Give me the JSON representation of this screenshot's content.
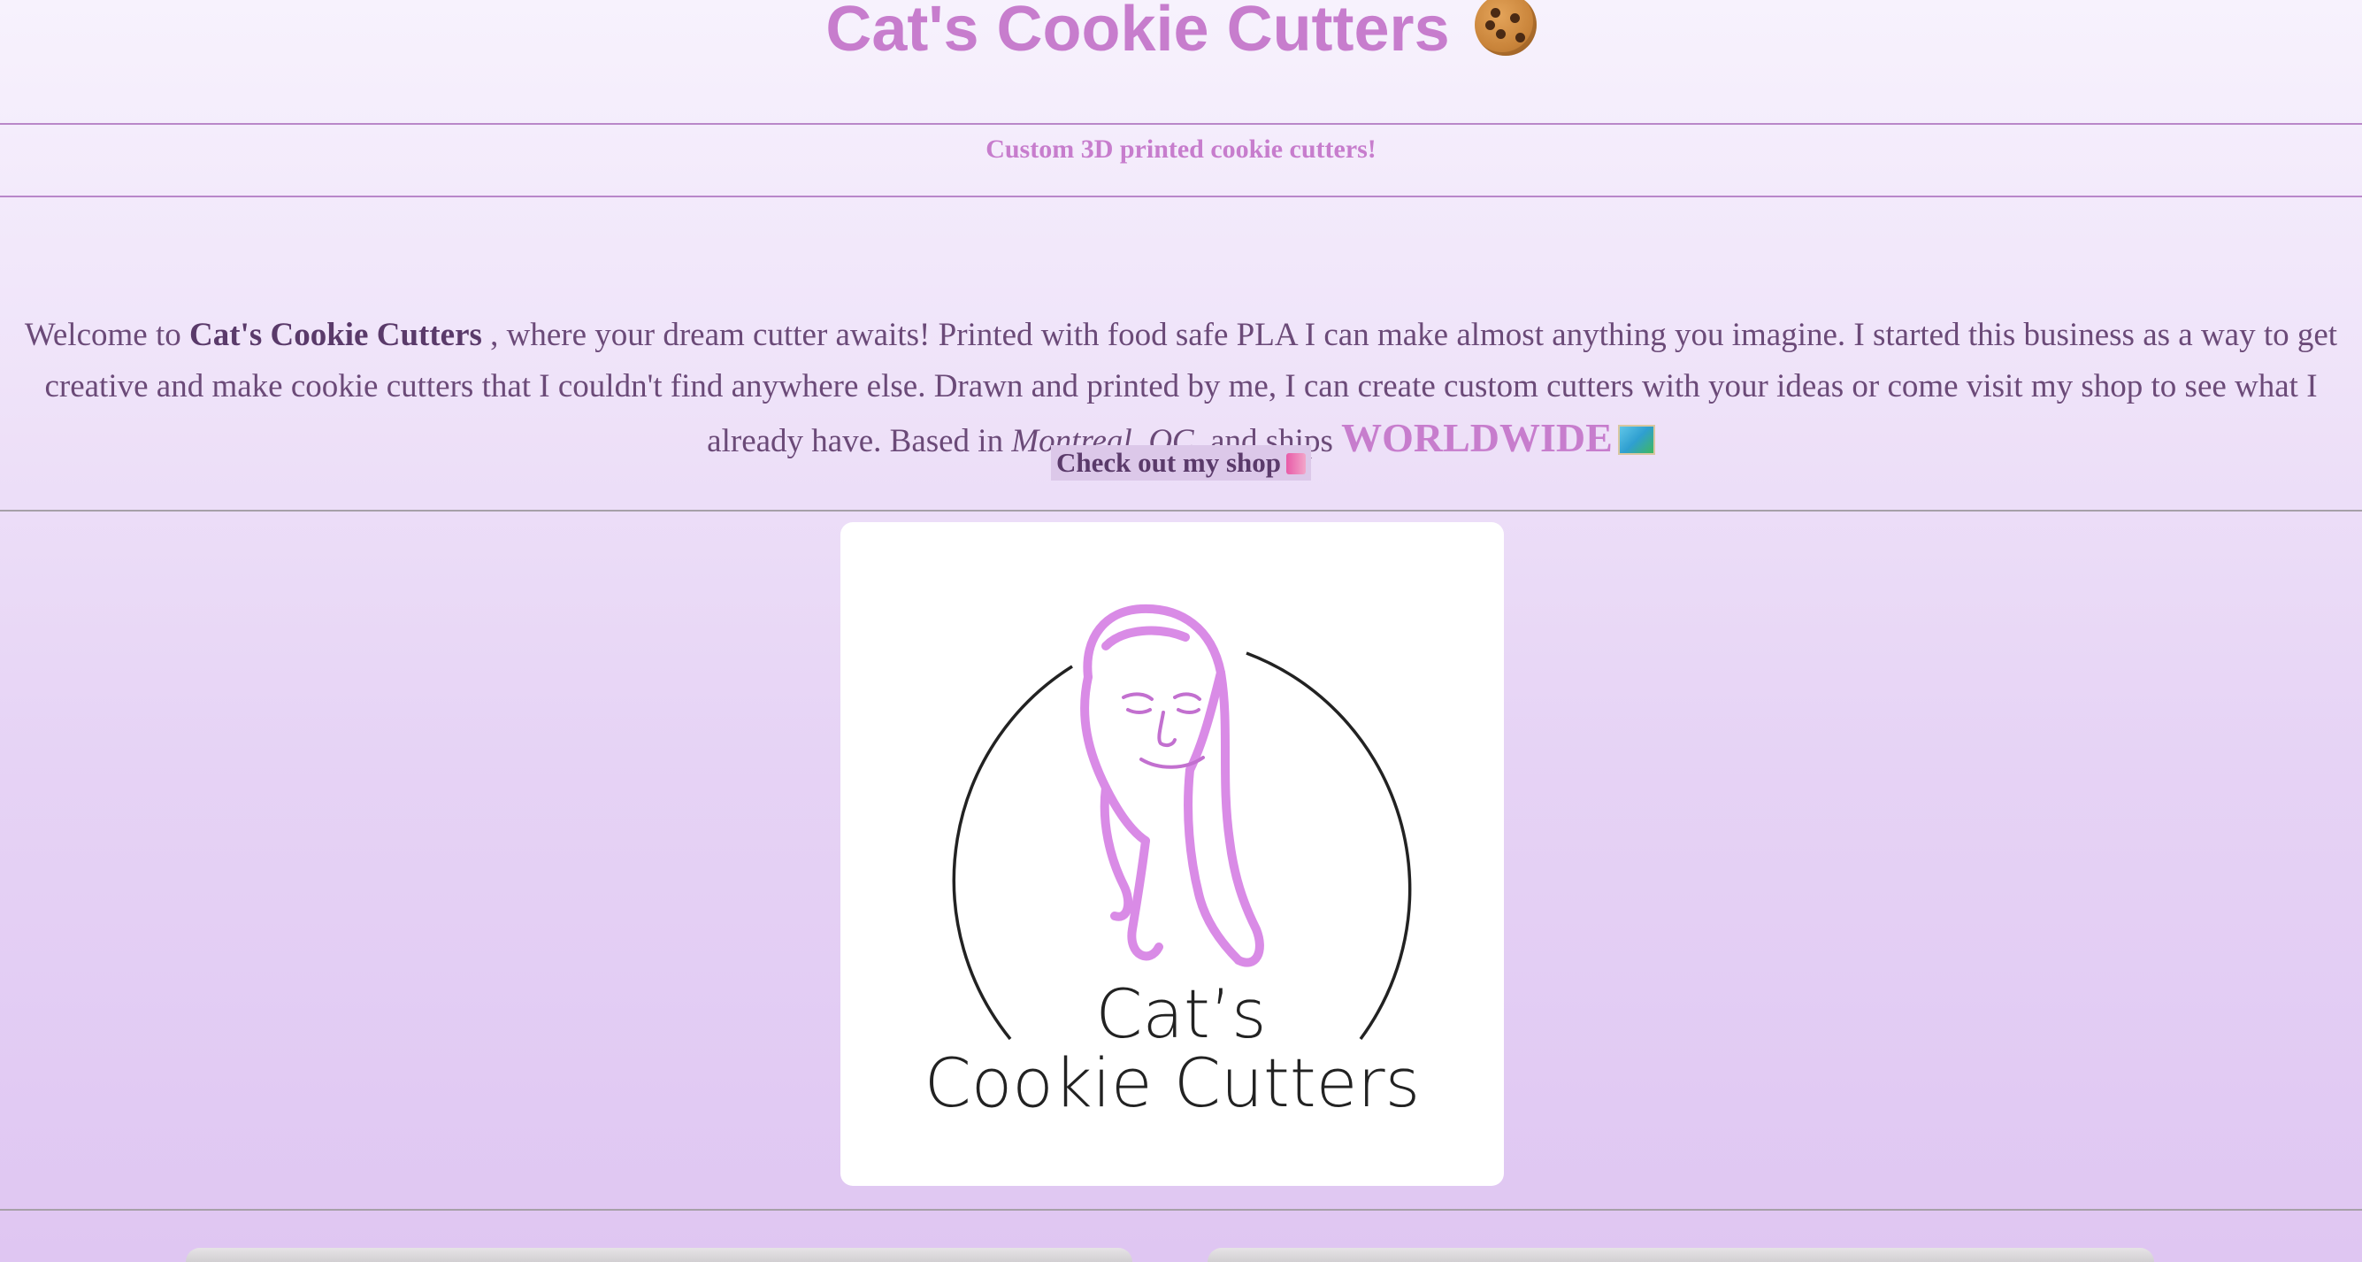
{
  "header": {
    "title": "Cat's Cookie Cutters",
    "title_icon": "cookie-icon",
    "tagline": "Custom 3D printed cookie cutters!"
  },
  "intro": {
    "part1": "Welcome to ",
    "brand": "Cat's Cookie Cutters",
    "part2": " , where your dream cutter awaits! Printed with food safe PLA I can make almost anything you imagine. I started this business as a way to get creative and make cookie cutters that I couldn't find anywhere else. Drawn and printed by me, I can create custom cutters with your ideas or come visit my shop to see what I already have. Based in ",
    "city": "Montreal",
    "comma": ", ",
    "province": "QC,",
    "part3": " and ships ",
    "worldwide": "WORLDWIDE",
    "map_icon": "world-map-icon"
  },
  "shop_link": {
    "label": "Check out my shop",
    "icon": "shopping-bags-icon"
  },
  "logo": {
    "line1": "Cat’s",
    "line2": "Cookie Cutters"
  },
  "colors": {
    "accent": "#c77dcd",
    "text": "#6b4a78",
    "background_top": "#f7f2fd",
    "background_bottom": "#dfc6f2",
    "logo_pink": "#d98be6"
  }
}
